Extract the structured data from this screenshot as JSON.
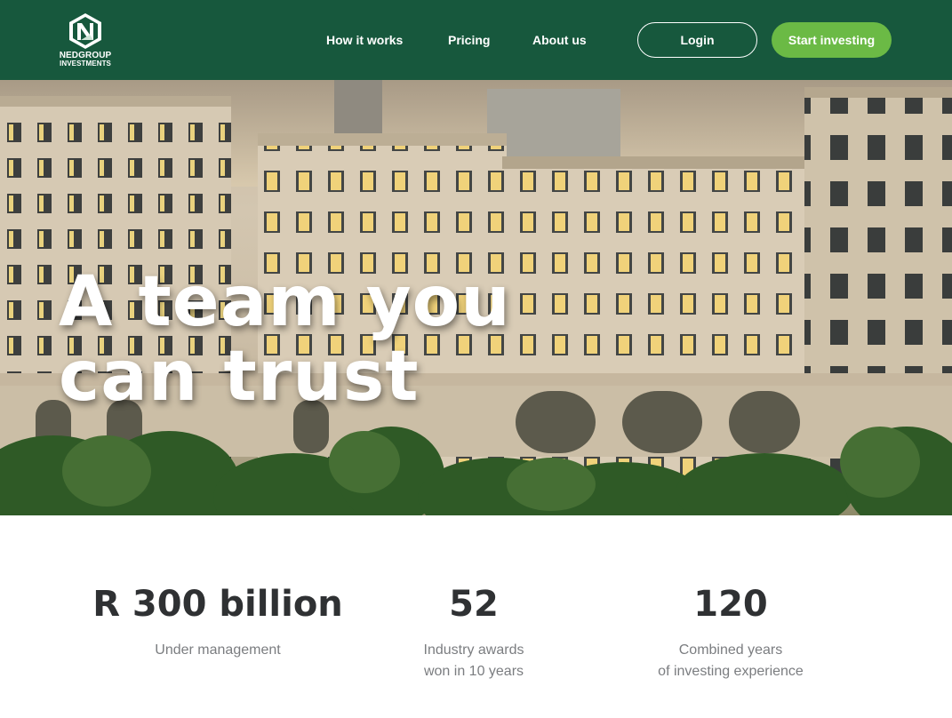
{
  "header": {
    "logo": {
      "line1": "NEDGROUP",
      "line2": "INVESTMENTS"
    },
    "nav": [
      {
        "label": "How it works"
      },
      {
        "label": "Pricing"
      },
      {
        "label": "About us"
      }
    ],
    "login_label": "Login",
    "start_label": "Start investing"
  },
  "hero": {
    "title_line1": "A team you",
    "title_line2": "can trust",
    "image": "building-photo"
  },
  "stats": [
    {
      "value": "R 300 billion",
      "label_line1": "Under management",
      "label_line2": ""
    },
    {
      "value": "52",
      "label_line1": "Industry awards",
      "label_line2": "won in 10 years"
    },
    {
      "value": "120",
      "label_line1": "Combined years",
      "label_line2": "of investing experience"
    }
  ],
  "colors": {
    "header_bg": "#17583d",
    "accent_green": "#6bba45",
    "stat_value": "#2f3133",
    "stat_label": "#7b7d80"
  }
}
